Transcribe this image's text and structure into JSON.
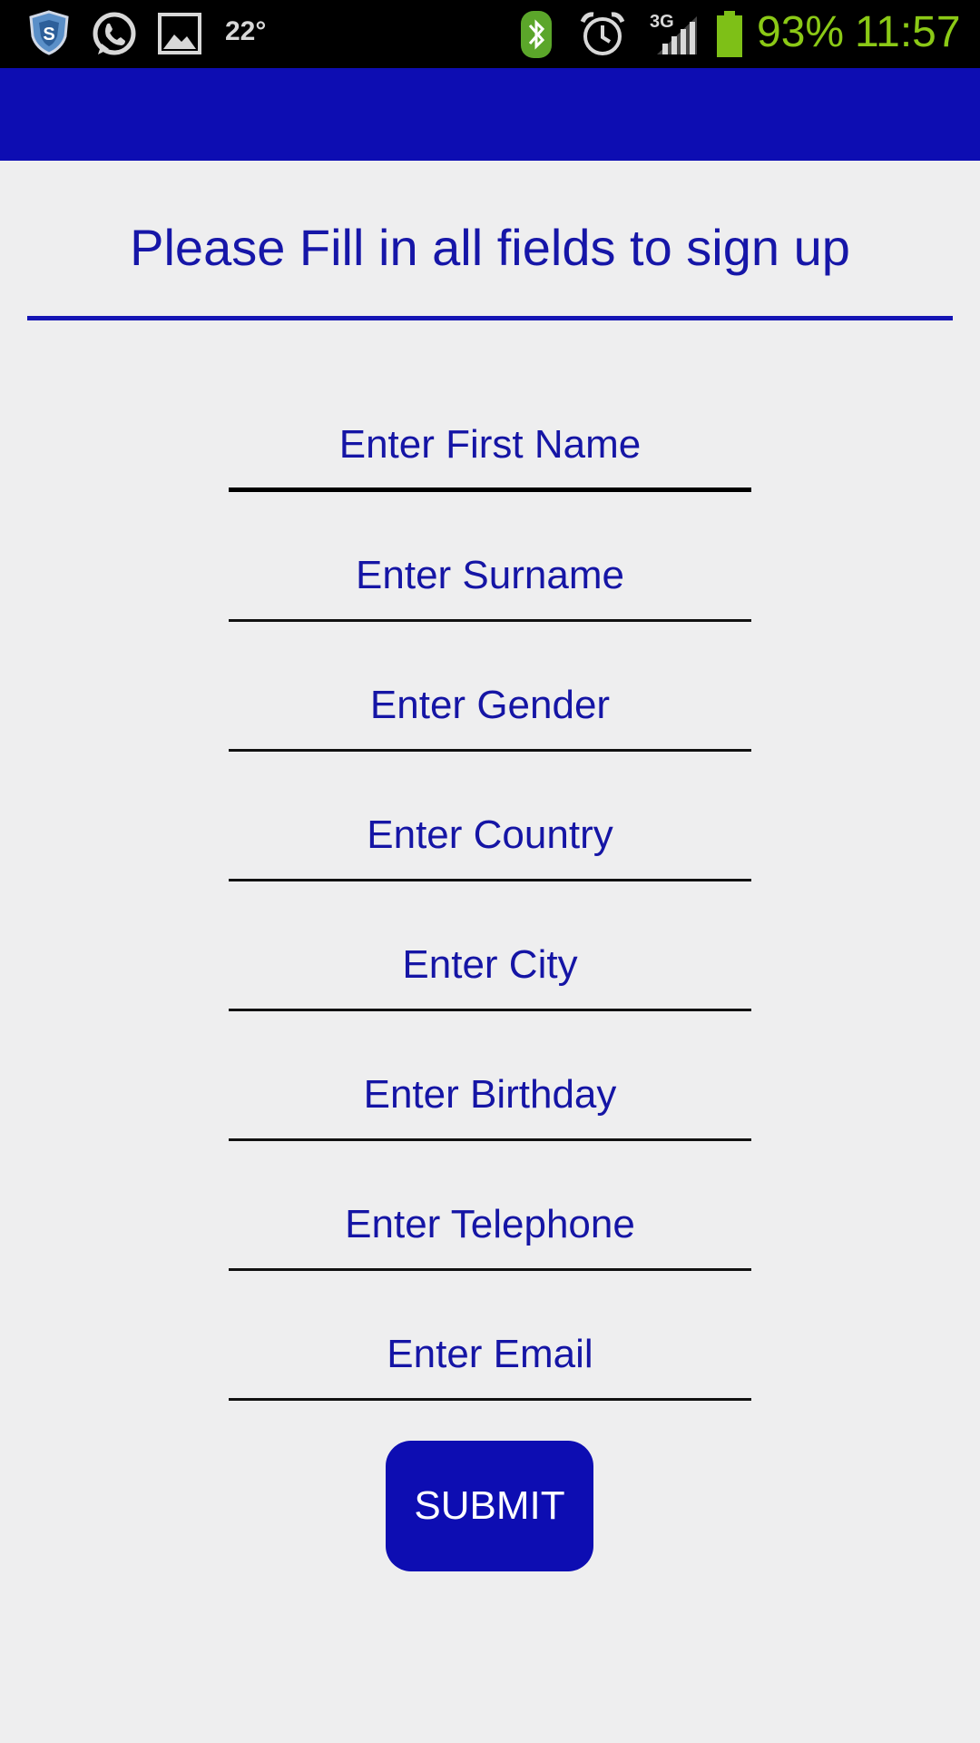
{
  "status_bar": {
    "temperature": "22°",
    "battery_percent": "93%",
    "time": "11:57",
    "network": "3G",
    "icons": [
      "shield-icon",
      "whatsapp-icon",
      "gallery-icon",
      "bluetooth-icon",
      "alarm-icon",
      "signal-icon",
      "battery-icon"
    ],
    "text_color": "#8bc916"
  },
  "action_bar": {
    "color": "#0d0db2"
  },
  "form": {
    "title": "Please Fill in all fields to sign up",
    "fields": [
      {
        "placeholder": "Enter First Name"
      },
      {
        "placeholder": "Enter Surname"
      },
      {
        "placeholder": "Enter Gender"
      },
      {
        "placeholder": "Enter Country"
      },
      {
        "placeholder": "Enter City"
      },
      {
        "placeholder": "Enter Birthday"
      },
      {
        "placeholder": "Enter Telephone"
      },
      {
        "placeholder": "Enter Email"
      }
    ],
    "submit_label": "SUBMIT"
  },
  "colors": {
    "accent": "#0d0db2",
    "text": "#1515a5",
    "background": "#eeeeef"
  }
}
